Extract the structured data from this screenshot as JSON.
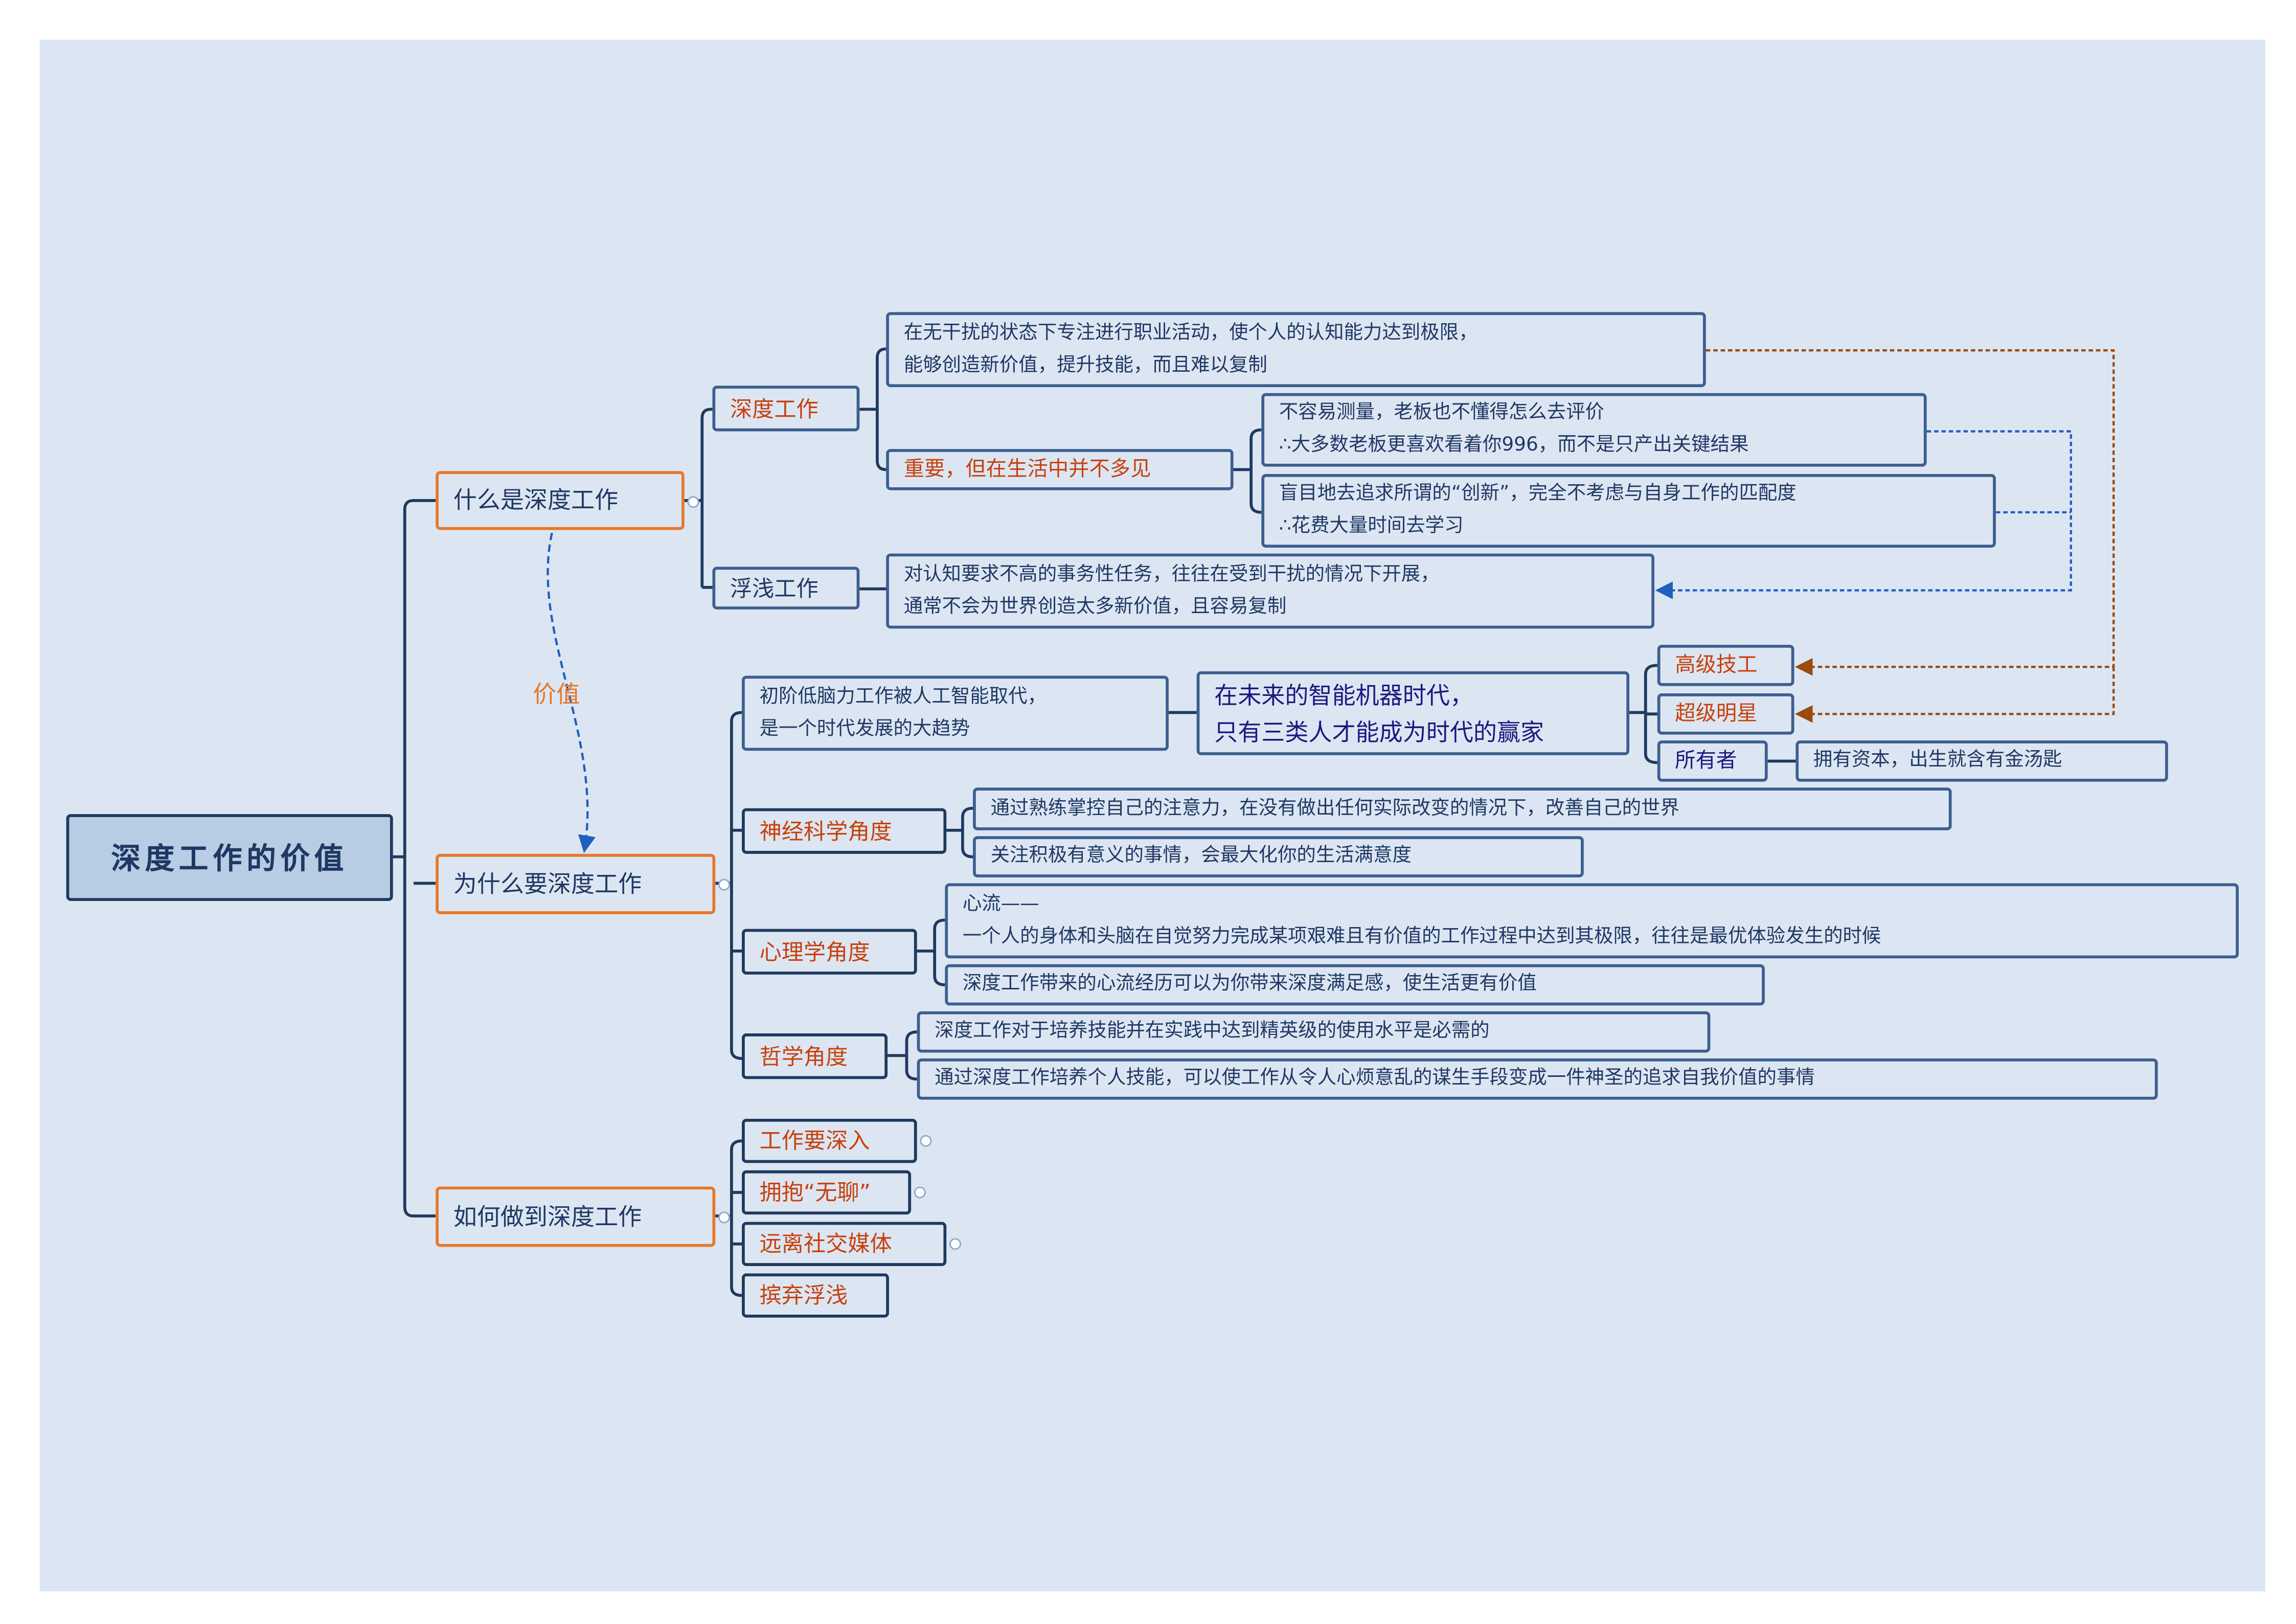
{
  "root": "深度工作的价值",
  "relation_label": "价值",
  "colors": {
    "background": "#dce6f2",
    "node_border": "#3d5f8f",
    "level1_border": "#e8782a",
    "emphasis_text": "#c8400c",
    "relation_brown": "#9c4a0e",
    "relation_blue": "#1f5fbf"
  },
  "what": {
    "label": "什么是深度工作",
    "deep": {
      "label": "深度工作",
      "definition": [
        "在无干扰的状态下专注进行职业活动，使个人的认知能力达到极限，",
        "能够创造新价值，提升技能，而且难以复制"
      ],
      "rare": {
        "label": "重要，但在生活中并不多见",
        "reasons": [
          [
            "不容易测量，老板也不懂得怎么去评价",
            "∴大多数老板更喜欢看着你996，而不是只产出关键结果"
          ],
          [
            "盲目地去追求所谓的“创新”，完全不考虑与自身工作的匹配度",
            "∴花费大量时间去学习"
          ]
        ]
      }
    },
    "shallow": {
      "label": "浮浅工作",
      "definition": [
        "对认知要求不高的事务性任务，往往在受到干扰的情况下开展，",
        "通常不会为世界创造太多新价值，且容易复制"
      ]
    }
  },
  "why": {
    "label": "为什么要深度工作",
    "trend": [
      "初阶低脑力工作被人工智能取代，",
      "是一个时代发展的大趋势"
    ],
    "future": [
      "在未来的智能机器时代，",
      "只有三类人才能成为时代的赢家"
    ],
    "winners": [
      "高级技工",
      "超级明星",
      "所有者"
    ],
    "owner_note": "拥有资本，出生就含有金汤匙",
    "neuro": {
      "label": "神经科学角度",
      "items": [
        "通过熟练掌控自己的注意力，在没有做出任何实际改变的情况下，改善自己的世界",
        "关注积极有意义的事情，会最大化你的生活满意度"
      ]
    },
    "psych": {
      "label": "心理学角度",
      "flow": [
        "心流——",
        "一个人的身体和头脑在自觉努力完成某项艰难且有价值的工作过程中达到其极限，往往是最优体验发生的时候"
      ],
      "item": "深度工作带来的心流经历可以为你带来深度满足感，使生活更有价值"
    },
    "phil": {
      "label": "哲学角度",
      "items": [
        "深度工作对于培养技能并在实践中达到精英级的使用水平是必需的",
        "通过深度工作培养个人技能，可以使工作从令人心烦意乱的谋生手段变成一件神圣的追求自我价值的事情"
      ]
    }
  },
  "how": {
    "label": "如何做到深度工作",
    "items": [
      "工作要深入",
      "拥抱“无聊”",
      "远离社交媒体",
      "摈弃浮浅"
    ]
  }
}
